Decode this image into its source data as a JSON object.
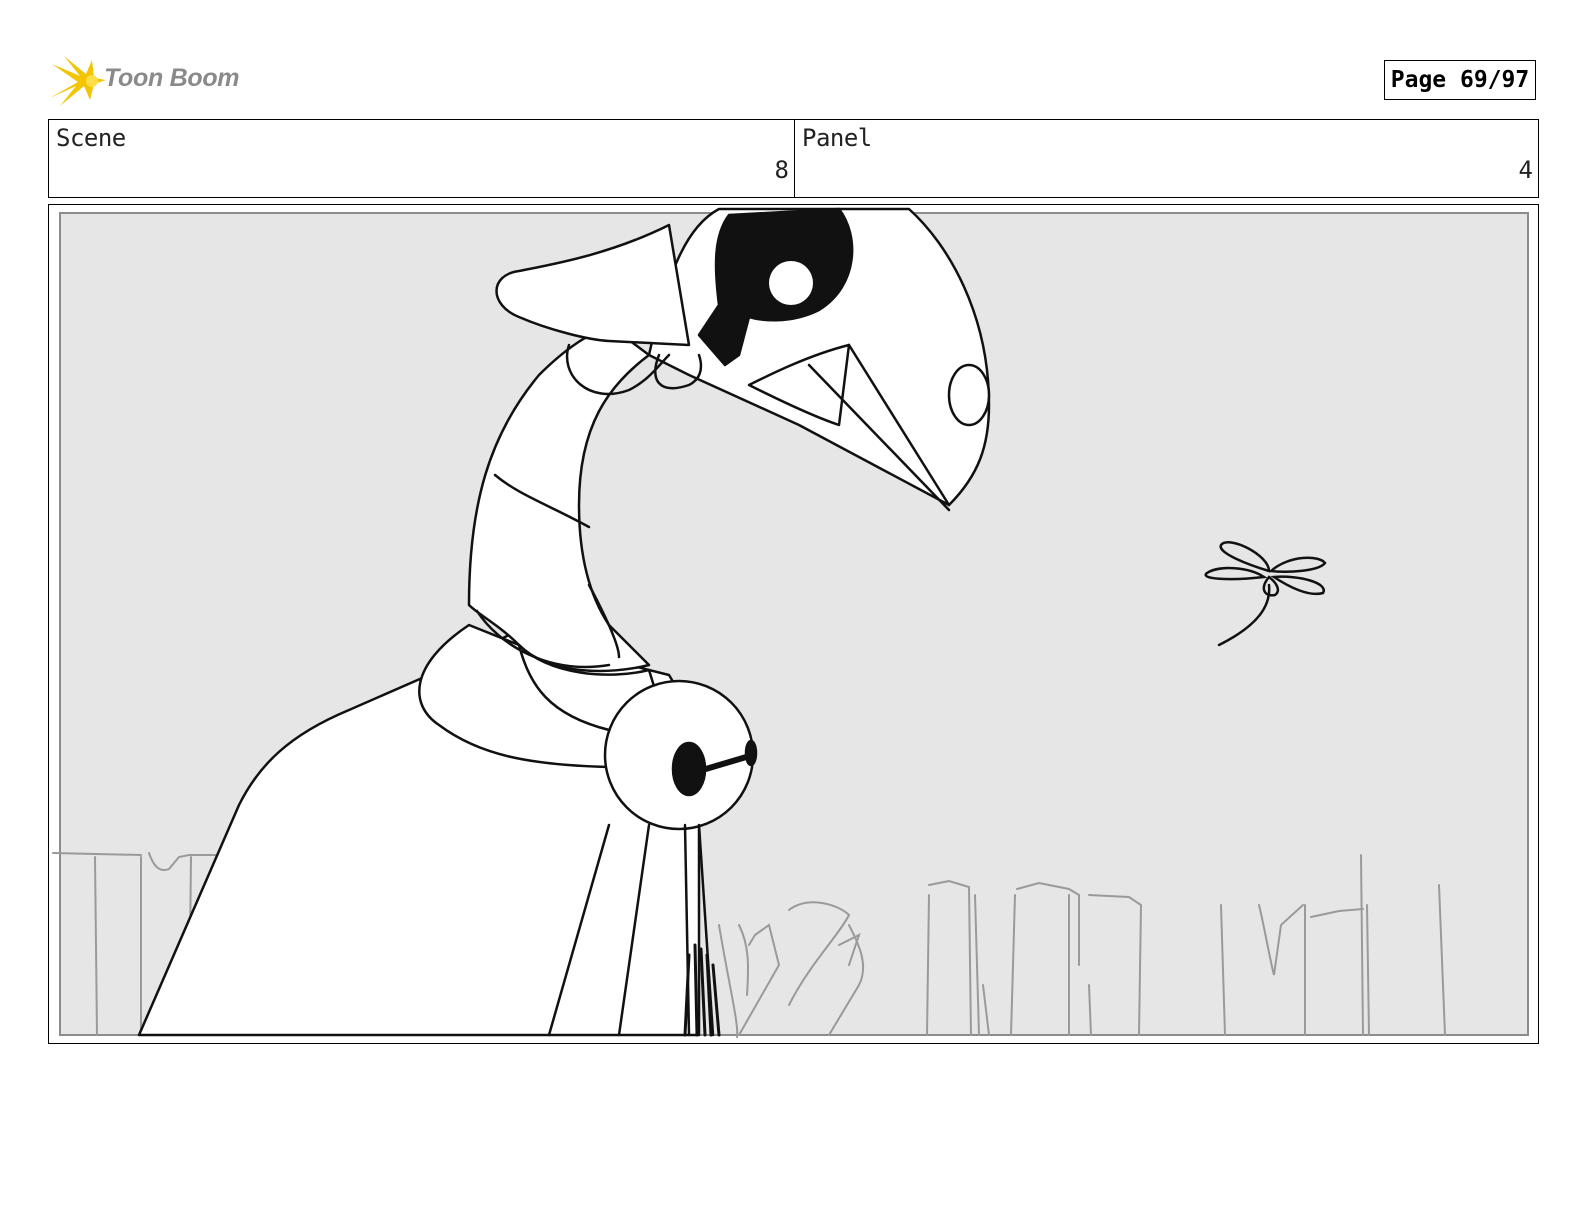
{
  "header": {
    "logo_text": "Toon Boom",
    "page_label": "Page 69/97"
  },
  "info": {
    "scene_label": "Scene",
    "scene_value": "8",
    "panel_label": "Panel",
    "panel_value": "4"
  },
  "colors": {
    "background_fill": "#e6e6e6",
    "ink": "#111111",
    "fence": "#9a9a9a",
    "logo_burst": "#f5c400"
  }
}
